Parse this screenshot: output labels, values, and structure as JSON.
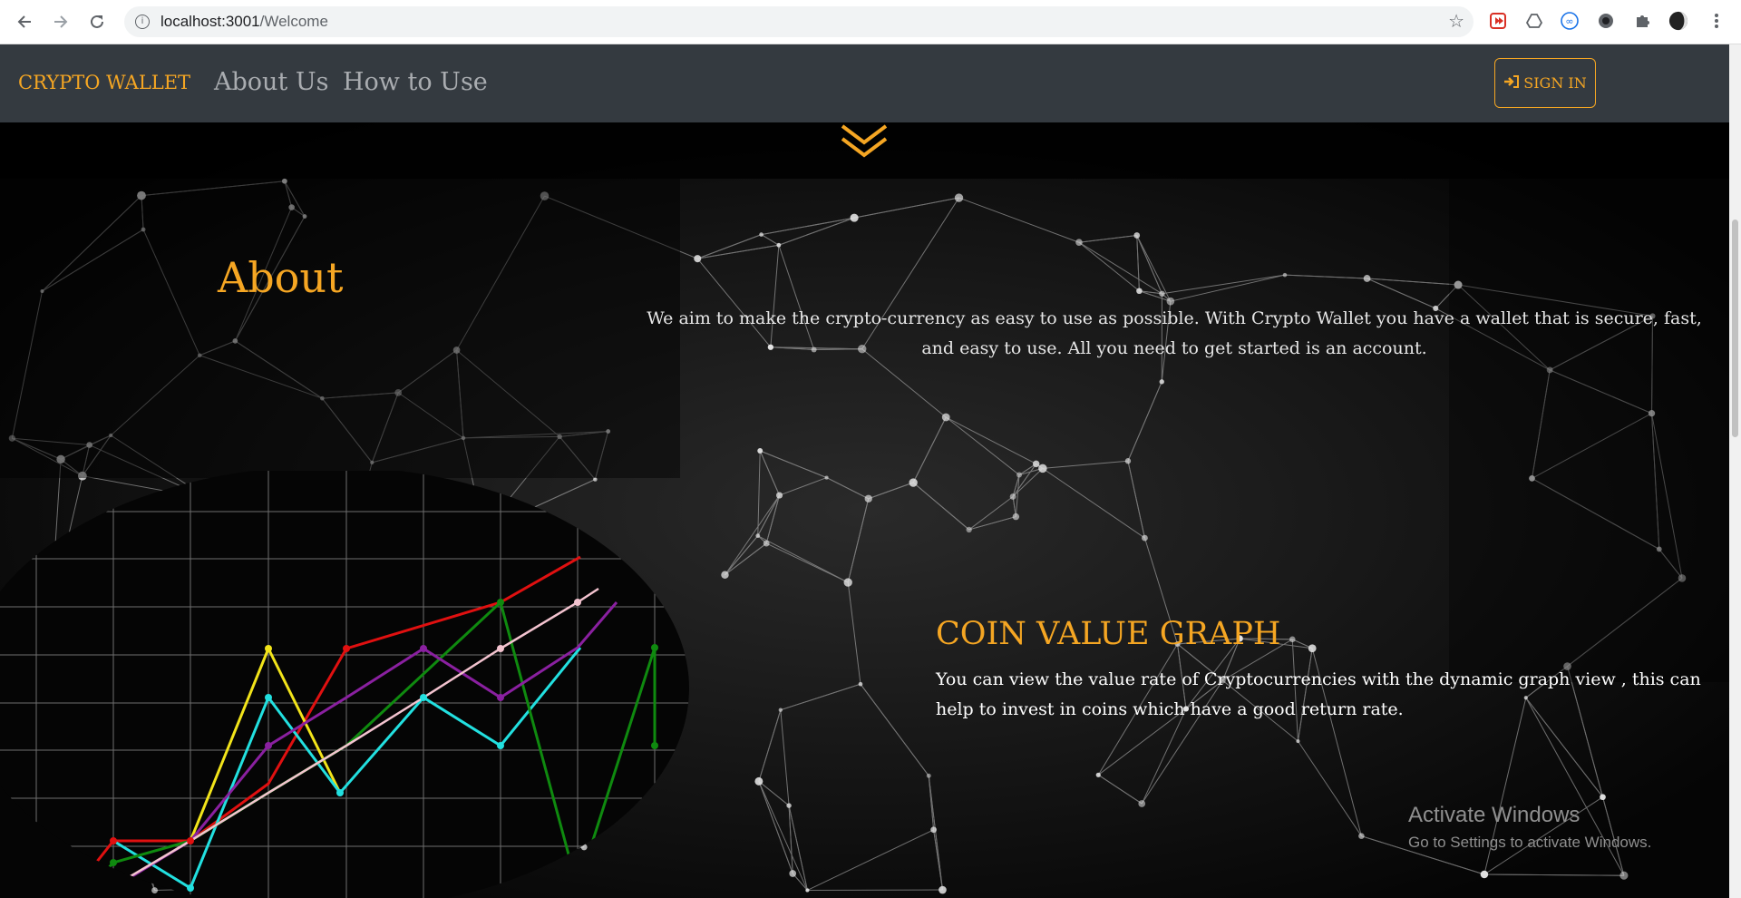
{
  "browser": {
    "url_host": "localhost:3001",
    "url_path": "/Welcome",
    "icons": [
      "back-icon",
      "forward-icon",
      "reload-icon",
      "info-icon",
      "star-icon",
      "extension-icons",
      "profile-avatar",
      "menu-icon"
    ]
  },
  "navbar": {
    "brand": "CRYPTO WALLET",
    "links": [
      "About Us",
      "How to Use"
    ],
    "signin": "SIGN IN"
  },
  "about": {
    "title": "About",
    "text": "We aim to make the crypto-currency as easy to use as possible. With Crypto Wallet you have a wallet that is secure, fast, and easy to use. All you need to get started is an account."
  },
  "graph_section": {
    "title": "COIN VALUE GRAPH",
    "text": "You can view the value rate of Cryptocurrencies with the dynamic graph view , this can help to invest in coins which have a good return rate."
  },
  "watermark": {
    "line1": "Activate Windows",
    "line2": "Go to Settings to activate Windows."
  },
  "colors": {
    "accent": "#f5a623",
    "navbar": "#343a40"
  }
}
